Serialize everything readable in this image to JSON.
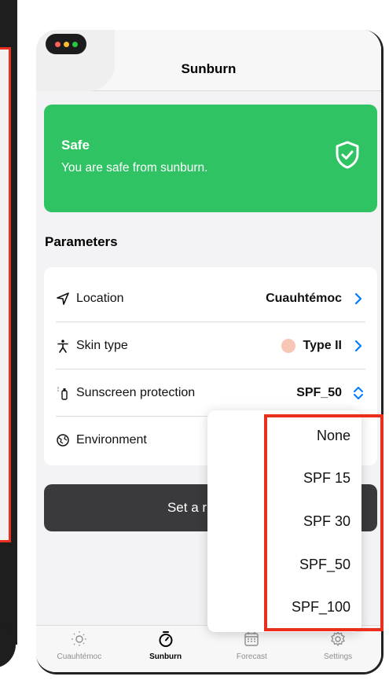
{
  "nav": {
    "title": "Sunburn"
  },
  "status_card": {
    "title": "Safe",
    "subtitle": "You are safe from sunburn.",
    "color": "#2fc364"
  },
  "parameters": {
    "title": "Parameters",
    "rows": [
      {
        "label": "Location",
        "value": "Cuauhtémoc",
        "icon": "location-arrow-icon"
      },
      {
        "label": "Skin type",
        "value": "Type II",
        "icon": "person-icon",
        "swatch_color": "#f7c6b5"
      },
      {
        "label": "Sunscreen protection",
        "value": "SPF_50",
        "icon": "sunscreen-icon"
      },
      {
        "label": "Environment",
        "value": "",
        "icon": "globe-icon"
      }
    ]
  },
  "reminder_button": {
    "label": "Set a r"
  },
  "dropdown": {
    "options": [
      "None",
      "SPF 15",
      "SPF 30",
      "SPF_50",
      "SPF_100"
    ],
    "selected": "SPF_50"
  },
  "tabbar": {
    "tabs": [
      {
        "label": "Cuauhtémoc",
        "icon": "sun-icon",
        "active": false
      },
      {
        "label": "Sunburn",
        "icon": "stopwatch-icon",
        "active": true
      },
      {
        "label": "Forecast",
        "icon": "calendar-icon",
        "active": false
      },
      {
        "label": "Settings",
        "icon": "gear-icon",
        "active": false
      }
    ]
  },
  "colors": {
    "accent": "#007aff",
    "highlight": "#e8301c",
    "button_dark": "#3a3a3c"
  }
}
